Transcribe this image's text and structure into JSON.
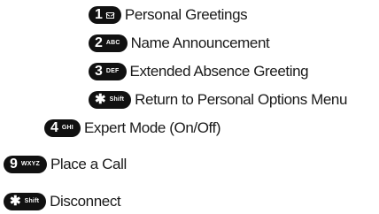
{
  "menu": {
    "items": [
      {
        "key": "1",
        "sub": "",
        "label": "Personal Greetings"
      },
      {
        "key": "2",
        "sub": "ABC",
        "label": "Name Announcement"
      },
      {
        "key": "3",
        "sub": "DEF",
        "label": "Extended Absence Greeting"
      },
      {
        "key": "✱",
        "sub": "Shift",
        "label": "Return to Personal Options Menu"
      },
      {
        "key": "4",
        "sub": "GHI",
        "label": "Expert Mode (On/Off)"
      },
      {
        "key": "9",
        "sub": "WXYZ",
        "label": "Place a Call"
      },
      {
        "key": "✱",
        "sub": "Shift",
        "label": "Disconnect"
      }
    ]
  },
  "icons": {
    "envelope": "envelope-icon",
    "star": "star-icon"
  }
}
